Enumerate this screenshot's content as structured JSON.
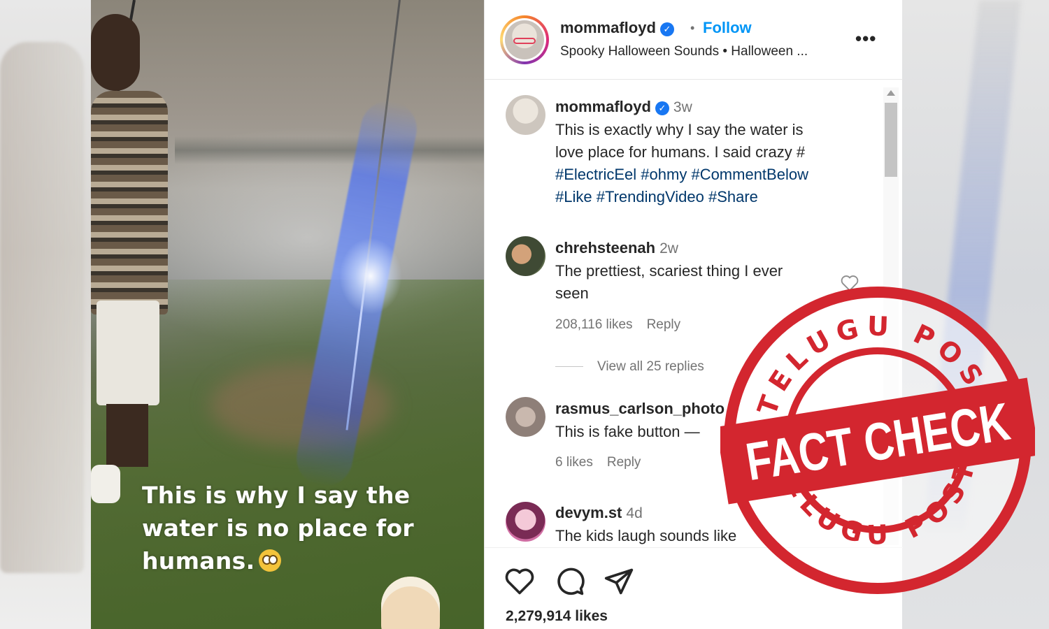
{
  "video": {
    "caption_line1": "This is why I say the",
    "caption_line2": "water is no place for",
    "caption_line3": "humans."
  },
  "header": {
    "username": "mommafloyd",
    "separator": "•",
    "follow_label": "Follow",
    "audio_line": "Spooky Halloween Sounds • Halloween ...",
    "more_label": "•••"
  },
  "caption": {
    "username": "mommafloyd",
    "time": "3w",
    "text_line1": "This is exactly why I say the water is",
    "text_line2": "love place for humans. I said crazy #",
    "hashtags_line1": [
      "#ElectricEel",
      "#ohmy",
      "#CommentBelow"
    ],
    "hashtags_line2": [
      "#Like",
      "#TrendingVideo",
      "#Share"
    ]
  },
  "comments": [
    {
      "username": "chrehsteenah",
      "time": "2w",
      "text_line1": "The prettiest, scariest thing I ever",
      "text_line2": "seen",
      "likes": "208,116 likes",
      "reply": "Reply",
      "view_replies": "View all 25 replies"
    },
    {
      "username": "rasmus_carlson_photo",
      "time": "",
      "text_line1": "This is fake button —",
      "likes": "6 likes",
      "reply": "Reply"
    },
    {
      "username": "devym.st",
      "time": "4d",
      "text_line1": "The kids laugh sounds like"
    }
  ],
  "actions": {
    "like_icon": "heart-icon",
    "comment_icon": "comment-icon",
    "share_icon": "share-icon",
    "likes_total": "2,279,914 likes"
  },
  "stamp": {
    "top_text": "TELUGU POST",
    "bottom_text": "TELUGU POST",
    "center_text": "FACT CHECK",
    "color": "#d3262f"
  },
  "colors": {
    "link_blue": "#0095f6",
    "hashtag": "#00376b",
    "verified": "#1877f2",
    "muted": "#737373"
  }
}
